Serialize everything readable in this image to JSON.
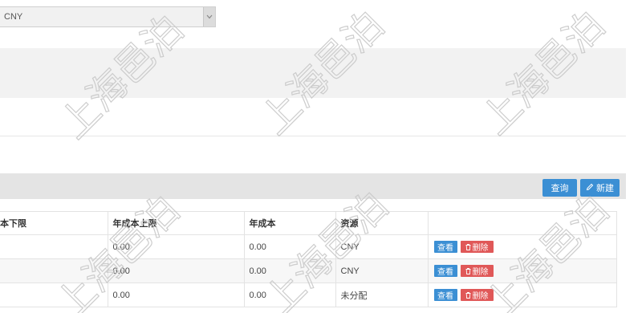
{
  "currency_select": {
    "value": "CNY"
  },
  "toolbar": {
    "query_label": "查询",
    "new_label": "新建"
  },
  "table": {
    "headers": [
      "本下限",
      "年成本上限",
      "年成本",
      "资源",
      ""
    ],
    "rows": [
      {
        "lower": "",
        "upper": "0.00",
        "annual_cost": "0.00",
        "resource": "CNY",
        "view_label": "查看",
        "delete_label": "删除"
      },
      {
        "lower": "",
        "upper": "0.00",
        "annual_cost": "0.00",
        "resource": "CNY",
        "view_label": "查看",
        "delete_label": "删除"
      },
      {
        "lower": "",
        "upper": "0.00",
        "annual_cost": "0.00",
        "resource": "未分配",
        "view_label": "查看",
        "delete_label": "删除"
      }
    ]
  },
  "watermark": {
    "text": "上海邑泊"
  },
  "colors": {
    "primary": "#3b8fd4",
    "danger": "#e05858"
  }
}
